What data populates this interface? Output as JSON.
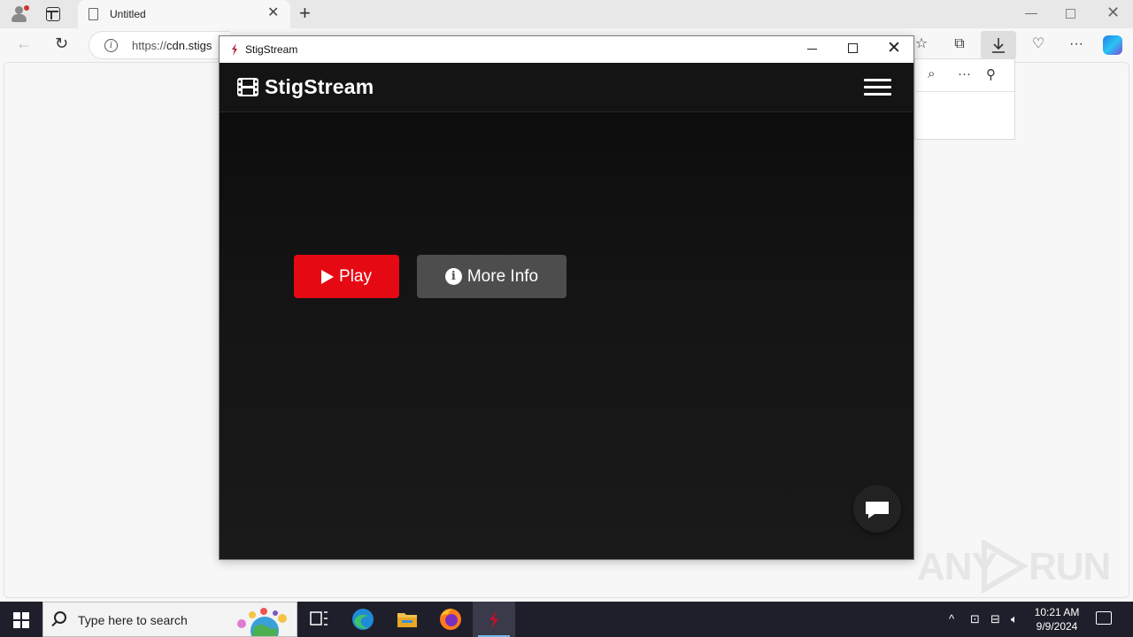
{
  "browser": {
    "tab_title": "Untitled",
    "url_scheme": "https://",
    "url_host": "cdn.stigs",
    "download_active": true
  },
  "app_window": {
    "title": "StigStream"
  },
  "app": {
    "brand": "StigStream",
    "accent_color": "#e50914",
    "buttons": {
      "play_label": "Play",
      "info_label": "More Info"
    }
  },
  "watermark": {
    "text_left": "ANY",
    "text_right": "RUN"
  },
  "taskbar": {
    "search_placeholder": "Type here to search",
    "time": "10:21 AM",
    "date": "9/9/2024"
  }
}
